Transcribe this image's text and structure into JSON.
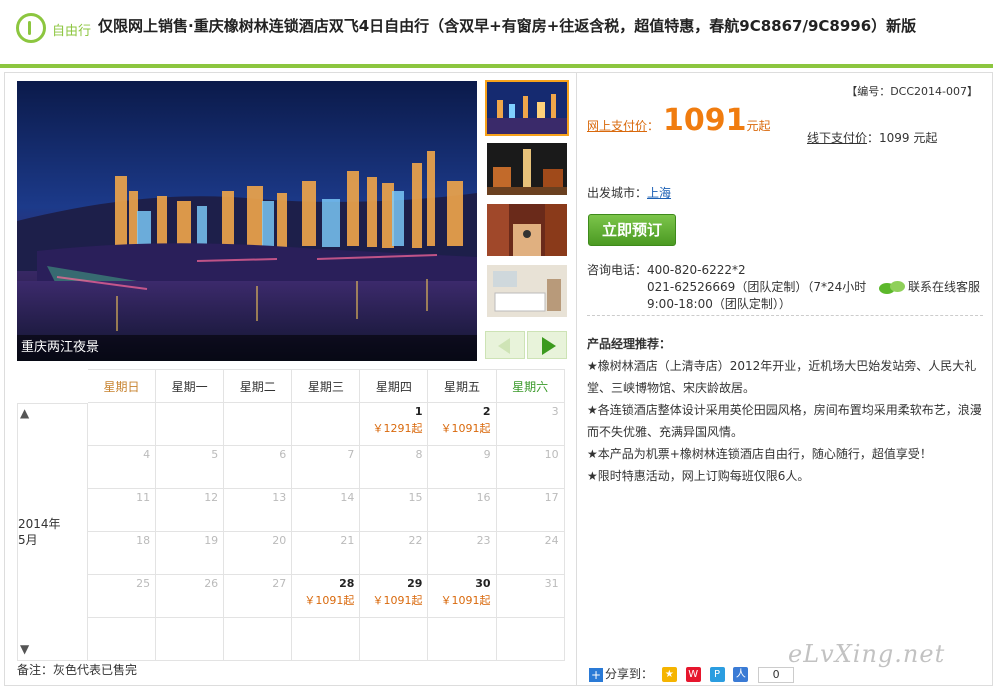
{
  "header": {
    "logo_label": "自由行",
    "title": "仅限网上销售·重庆橡树林连锁酒店双飞4日自由行（含双早+有窗房+往返含税，超值特惠，春航9C8867/9C8996）新版"
  },
  "gallery": {
    "main_caption": "重庆两江夜景",
    "thumbnails": [
      "night-skyline",
      "tower-night",
      "street-scene",
      "hotel-room"
    ]
  },
  "calendar": {
    "weekdays": [
      "星期日",
      "星期一",
      "星期二",
      "星期三",
      "星期四",
      "星期五",
      "星期六"
    ],
    "month_label": "2014年\n5月",
    "up_arrow": "▲",
    "down_arrow": "▼",
    "weeks": [
      [
        {
          "d": ""
        },
        {
          "d": ""
        },
        {
          "d": ""
        },
        {
          "d": ""
        },
        {
          "d": "1",
          "p": "￥1291起"
        },
        {
          "d": "2",
          "p": "￥1091起"
        },
        {
          "d": "3"
        }
      ],
      [
        {
          "d": "4"
        },
        {
          "d": "5"
        },
        {
          "d": "6"
        },
        {
          "d": "7"
        },
        {
          "d": "8"
        },
        {
          "d": "9"
        },
        {
          "d": "10"
        }
      ],
      [
        {
          "d": "11"
        },
        {
          "d": "12"
        },
        {
          "d": "13"
        },
        {
          "d": "14"
        },
        {
          "d": "15"
        },
        {
          "d": "16"
        },
        {
          "d": "17"
        }
      ],
      [
        {
          "d": "18"
        },
        {
          "d": "19"
        },
        {
          "d": "20"
        },
        {
          "d": "21"
        },
        {
          "d": "22"
        },
        {
          "d": "23"
        },
        {
          "d": "24"
        }
      ],
      [
        {
          "d": "25"
        },
        {
          "d": "26"
        },
        {
          "d": "27"
        },
        {
          "d": "28",
          "p": "￥1091起"
        },
        {
          "d": "29",
          "p": "￥1091起"
        },
        {
          "d": "30",
          "p": "￥1091起"
        },
        {
          "d": "31"
        }
      ],
      [
        {
          "d": ""
        },
        {
          "d": ""
        },
        {
          "d": ""
        },
        {
          "d": ""
        },
        {
          "d": ""
        },
        {
          "d": ""
        },
        {
          "d": ""
        }
      ]
    ],
    "note": "备注：灰色代表已售完"
  },
  "info": {
    "code": "【编号：DCC2014-007】",
    "online_label": "网上支付价",
    "online_colon": "：",
    "online_price": "1091",
    "online_unit": "元起",
    "offline_label": "线下支付价",
    "offline_value": "：1099 元起",
    "depart_label": "出发城市：",
    "depart_city": "上海",
    "book_button": "立即预订",
    "consult_line1": "咨询电话：400-820-6222*2",
    "consult_line2": "021-62526669（团队定制）（7*24小时",
    "consult_line3": "9:00-18:00（团队定制））",
    "service_label": "联系在线客服",
    "manager_title": "产品经理推荐：",
    "manager_points": [
      "★橡树林酒店（上清寺店）2012年开业，近机场大巴始发站旁、人民大礼堂、三峡博物馆、宋庆龄故居。",
      "★各连锁酒店整体设计采用英伦田园风格，房间布置均采用柔软布艺，浪漫而不失优雅、充满异国风情。",
      "★本产品为机票+橡树林连锁酒店自由行，随心随行，超值享受！",
      "★限时特惠活动，网上订购每班仅限6人。"
    ],
    "share_label": "分享到：",
    "share_count": "0"
  },
  "watermark": "eLvXing.net",
  "colors": {
    "brand_green": "#8cc63f",
    "price_orange": "#f07c0f",
    "button_green": "#4b9a22"
  }
}
